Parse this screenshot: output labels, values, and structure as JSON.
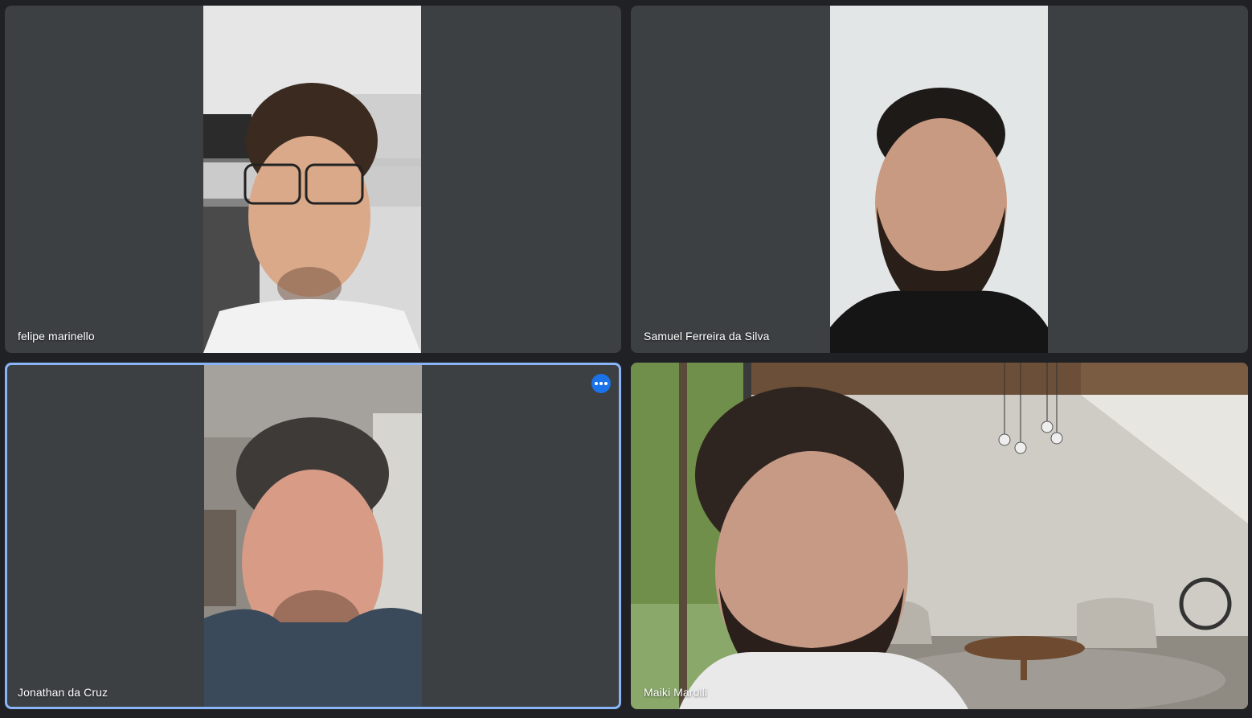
{
  "participants": [
    {
      "name": "felipe marinello"
    },
    {
      "name": "Samuel Ferreira da Silva"
    },
    {
      "name": "Jonathan da Cruz",
      "pinned_highlight": true
    },
    {
      "name": "Maiki Marolli"
    }
  ],
  "colors": {
    "background": "#202124",
    "tile": "#3c4043",
    "highlight_border": "#8ab4f8",
    "menu_button": "#1a73e8"
  },
  "icons": {
    "more_options": "more-horiz-icon"
  }
}
